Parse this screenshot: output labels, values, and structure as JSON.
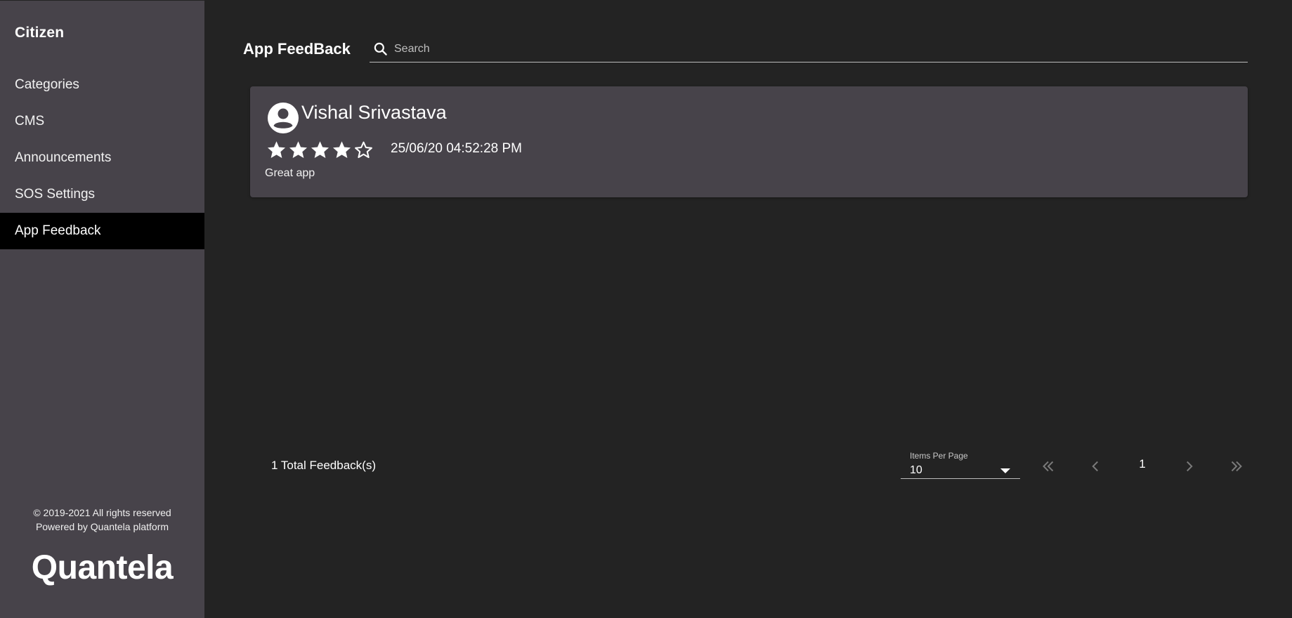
{
  "sidebar": {
    "brand": "Citizen",
    "items": [
      {
        "label": "Categories"
      },
      {
        "label": "CMS"
      },
      {
        "label": "Announcements"
      },
      {
        "label": "SOS Settings"
      },
      {
        "label": "App Feedback",
        "active": true
      }
    ],
    "copyright": "© 2019-2021 All rights reserved",
    "powered_by": "Powered by Quantela platform",
    "logo_text": "Quantela"
  },
  "header": {
    "title": "App FeedBack",
    "search_placeholder": "Search"
  },
  "feedback": [
    {
      "user": "Vishal Srivastava",
      "rating": 4,
      "max_rating": 5,
      "timestamp": "25/06/20 04:52:28 PM",
      "comment": "Great app"
    }
  ],
  "footer": {
    "total": "1 Total Feedback(s)",
    "items_per_page_label": "Items Per Page",
    "items_per_page_value": "10",
    "current_page": "1"
  },
  "icons": {
    "search": "search-icon",
    "avatar": "account-circle-icon",
    "star_filled": "star-icon",
    "star_empty": "star-outline-icon",
    "first": "double-chevron-left-icon",
    "prev": "chevron-left-icon",
    "next": "chevron-right-icon",
    "last": "double-chevron-right-icon"
  },
  "colors": {
    "background": "#232323",
    "sidebar": "#47434a",
    "card": "#47434a",
    "active_item": "#000000",
    "text": "#ffffff"
  }
}
